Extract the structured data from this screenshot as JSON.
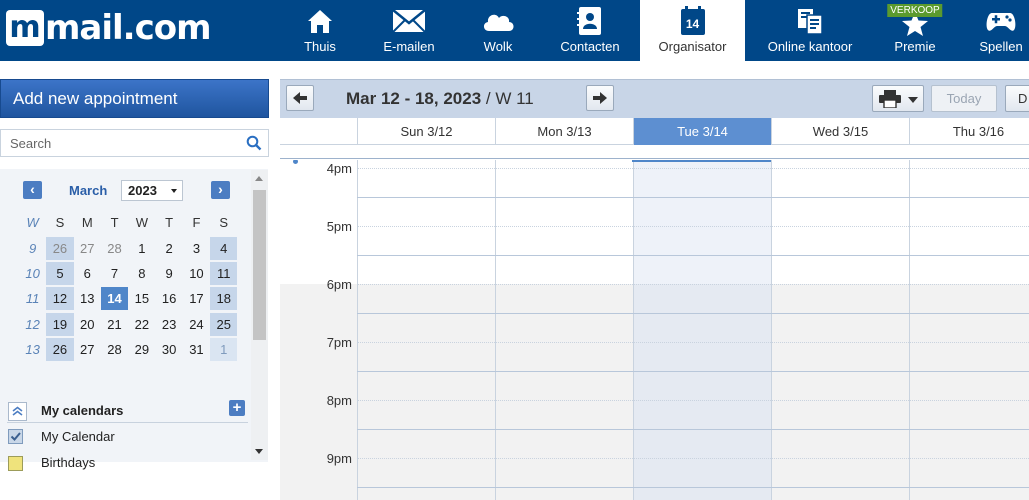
{
  "brand": {
    "logo_text": "mail.com"
  },
  "nav": [
    {
      "label": "Thuis",
      "icon": "home-icon"
    },
    {
      "label": "E-mailen",
      "icon": "envelope-icon"
    },
    {
      "label": "Wolk",
      "icon": "cloud-icon"
    },
    {
      "label": "Contacten",
      "icon": "contacts-book-icon"
    },
    {
      "label": "Organisator",
      "icon": "calendar-icon",
      "icon_text": "14",
      "active": true
    },
    {
      "label": "Online kantoor",
      "icon": "office-docs-icon"
    },
    {
      "label": "Premie",
      "icon": "star-icon",
      "badge": "VERKOOP"
    },
    {
      "label": "Spellen",
      "icon": "gamepad-icon"
    }
  ],
  "sidebar": {
    "add_button": "Add new appointment",
    "search_placeholder": "Search",
    "mini_calendar": {
      "month": "March",
      "year": "2023",
      "headers": [
        "W",
        "S",
        "M",
        "T",
        "W",
        "T",
        "F",
        "S"
      ],
      "weeks": [
        {
          "wk": "9",
          "days": [
            "26",
            "27",
            "28",
            "1",
            "2",
            "3",
            "4"
          ]
        },
        {
          "wk": "10",
          "days": [
            "5",
            "6",
            "7",
            "8",
            "9",
            "10",
            "11"
          ]
        },
        {
          "wk": "11",
          "days": [
            "12",
            "13",
            "14",
            "15",
            "16",
            "17",
            "18"
          ]
        },
        {
          "wk": "12",
          "days": [
            "19",
            "20",
            "21",
            "22",
            "23",
            "24",
            "25"
          ]
        },
        {
          "wk": "13",
          "days": [
            "26",
            "27",
            "28",
            "29",
            "30",
            "31",
            "1"
          ]
        }
      ],
      "today": "14"
    },
    "calendars": {
      "title": "My calendars",
      "items": [
        {
          "label": "My Calendar",
          "checked": true
        },
        {
          "label": "Birthdays",
          "checked": false
        }
      ]
    }
  },
  "calendar": {
    "range_bold": "Mar 12 - 18, 2023",
    "range_week": "/ W 11",
    "today_label": "Today",
    "view_label": "D",
    "days": [
      {
        "label": "Sun 3/12",
        "today": false
      },
      {
        "label": "Mon 3/13",
        "today": false
      },
      {
        "label": "Tue 3/14",
        "today": true
      },
      {
        "label": "Wed 3/15",
        "today": false
      },
      {
        "label": "Thu 3/16",
        "today": false
      }
    ],
    "hours": [
      "4pm",
      "5pm",
      "6pm",
      "7pm",
      "8pm",
      "9pm"
    ]
  }
}
